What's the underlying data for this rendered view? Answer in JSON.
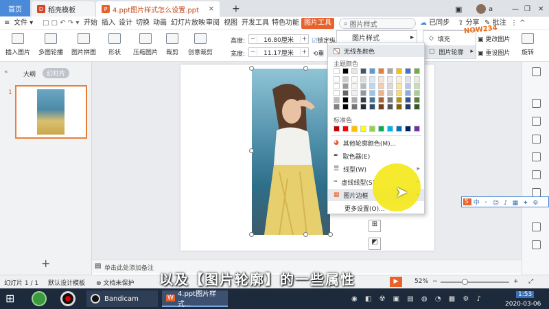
{
  "tabs": {
    "home": "首页",
    "template": "稻壳模板",
    "document": "4.ppt图片样式怎么设置.ppt",
    "add": "+"
  },
  "user": {
    "name": "a"
  },
  "menu": {
    "file": "文件",
    "items": [
      "开始",
      "插入",
      "设计",
      "切换",
      "动画",
      "幻灯片放映",
      "审阅",
      "视图",
      "开发工具",
      "特色功能"
    ],
    "active": "图片工具",
    "search_placeholder": "图片样式",
    "sync": "已同步",
    "share": "分享",
    "comment": "批注"
  },
  "toolbar": {
    "insert_picture": "插入图片",
    "multi_carousel": "多图轮播",
    "picture_collage": "图片拼图",
    "shape": "形状",
    "compress": "压缩图片",
    "crop": "裁剪",
    "creative_crop": "创意裁剪",
    "height_label": "高度:",
    "height_value": "16.80厘米",
    "width_label": "宽度:",
    "width_value": "11.17厘米",
    "lock_ratio": "锁定纵",
    "reset": "重",
    "rotate": "旋转"
  },
  "submenu": {
    "picture_style": "图片样式",
    "fill": "填充",
    "outline": "图片轮廓",
    "change": "更改图片",
    "reset_style": "重设图片"
  },
  "dropdown": {
    "no_outline": "无线条颜色",
    "theme_colors": "主题颜色",
    "standard_colors": "标准色",
    "more_colors": "其他轮廓颜色(M)...",
    "eyedropper": "取色器(E)",
    "line_type": "线型(W)",
    "dash_type": "虚线线型(S)",
    "picture_border": "图片边框",
    "more_settings": "更多设置(O)..."
  },
  "colors": {
    "accent": "#e8622c",
    "tab_active": "#4a8ad8",
    "theme_row": [
      "#ffffff",
      "#000000",
      "#e7e6e6",
      "#44546a",
      "#5b9bd5",
      "#ed7d31",
      "#a5a5a5",
      "#ffc000",
      "#4472c4",
      "#70ad47"
    ],
    "standard": [
      "#c00000",
      "#ff0000",
      "#ffc000",
      "#ffff00",
      "#92d050",
      "#00b050",
      "#00b0f0",
      "#0070c0",
      "#002060",
      "#7030a0"
    ]
  },
  "leftpane": {
    "outline_tab": "大纲",
    "slides_tab": "幻灯片",
    "slide_number": "1",
    "add": "+"
  },
  "notes": {
    "placeholder": "单击此处添加备注"
  },
  "status": {
    "slide": "幻灯片 1 / 1",
    "theme": "默认设计模板",
    "protection": "文档未保护",
    "zoom": "52%"
  },
  "subtitle": "以及【图片轮廓】的一些属性",
  "taskbar": {
    "bandicam": "Bandicam",
    "ppt": "4.ppt图片样式...",
    "time": "1:53",
    "date": "2020-03-06"
  },
  "watermark": "NOW234"
}
